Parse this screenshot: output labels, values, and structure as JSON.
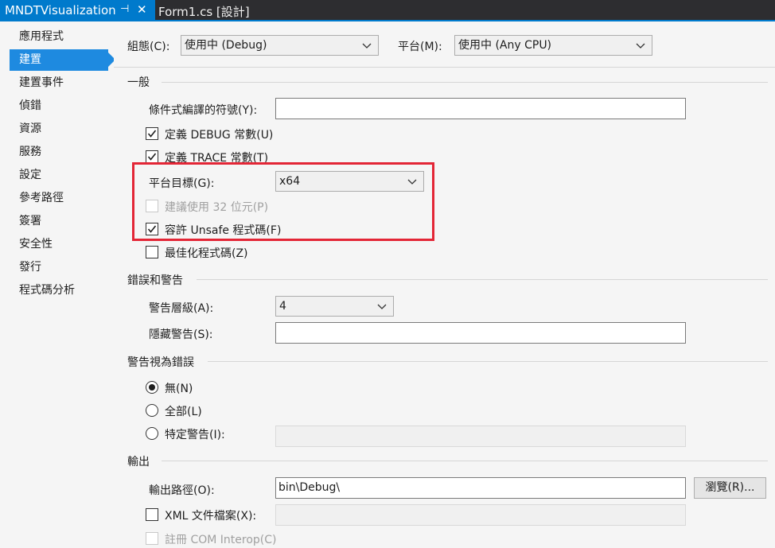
{
  "tabs": {
    "active": {
      "title": "MNDTVisualization",
      "pin_glyph": "⊣",
      "close_glyph": "✕"
    },
    "inactive": {
      "title": "Form1.cs [設計]"
    }
  },
  "sidebar": {
    "items": [
      {
        "label": "應用程式"
      },
      {
        "label": "建置"
      },
      {
        "label": "建置事件"
      },
      {
        "label": "偵錯"
      },
      {
        "label": "資源"
      },
      {
        "label": "服務"
      },
      {
        "label": "設定"
      },
      {
        "label": "參考路徑"
      },
      {
        "label": "簽署"
      },
      {
        "label": "安全性"
      },
      {
        "label": "發行"
      },
      {
        "label": "程式碼分析"
      }
    ],
    "active_index": 1
  },
  "config": {
    "config_label": "組態(C):",
    "config_value": "使用中 (Debug)",
    "platform_label": "平台(M):",
    "platform_value": "使用中 (Any CPU)"
  },
  "general": {
    "title": "一般",
    "symbols_label": "條件式編譯的符號(Y):",
    "symbols_value": "",
    "define_debug_label": "定義 DEBUG 常數(U)",
    "define_debug_checked": true,
    "define_trace_label": "定義 TRACE 常數(T)",
    "define_trace_checked": true,
    "platform_target_label": "平台目標(G):",
    "platform_target_value": "x64",
    "prefer32_label": "建議使用 32 位元(P)",
    "prefer32_checked": false,
    "unsafe_label": "容許 Unsafe 程式碼(F)",
    "unsafe_checked": true,
    "optimize_label": "最佳化程式碼(Z)",
    "optimize_checked": false
  },
  "errors": {
    "title": "錯誤和警告",
    "warning_level_label": "警告層級(A):",
    "warning_level_value": "4",
    "suppress_label": "隱藏警告(S):",
    "suppress_value": ""
  },
  "treat_warnings": {
    "title": "警告視為錯誤",
    "none_label": "無(N)",
    "all_label": "全部(L)",
    "specific_label": "特定警告(I):",
    "selected": "none",
    "specific_value": ""
  },
  "output": {
    "title": "輸出",
    "path_label": "輸出路徑(O):",
    "path_value": "bin\\Debug\\",
    "browse_label": "瀏覽(R)...",
    "xml_label": "XML 文件檔案(X):",
    "xml_checked": false,
    "xml_value": "",
    "com_label": "註冊 COM Interop(C)"
  },
  "colors": {
    "accent": "#007acc",
    "nav_selected": "#1e8ae0",
    "highlight_box": "#e32636"
  }
}
